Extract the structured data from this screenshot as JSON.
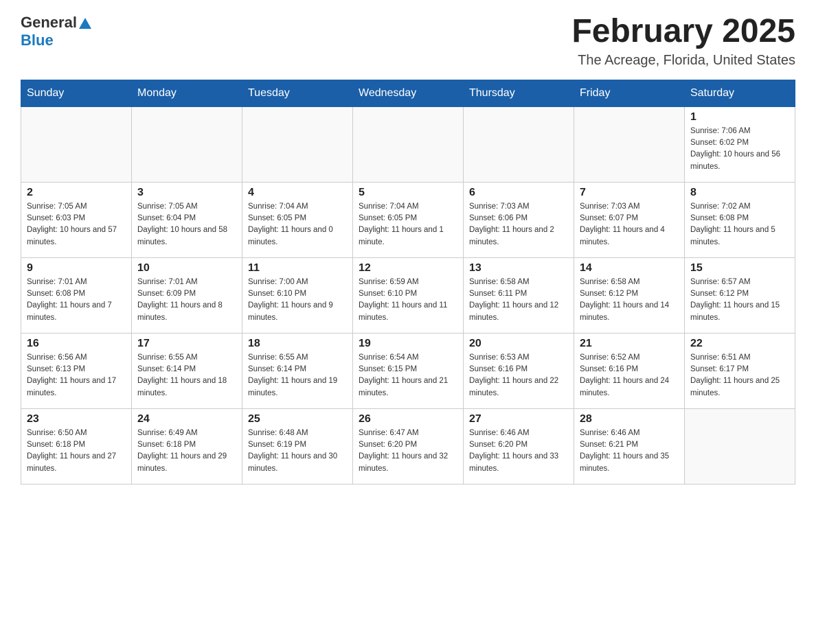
{
  "header": {
    "logo_general": "General",
    "logo_blue": "Blue",
    "title": "February 2025",
    "subtitle": "The Acreage, Florida, United States"
  },
  "days_of_week": [
    "Sunday",
    "Monday",
    "Tuesday",
    "Wednesday",
    "Thursday",
    "Friday",
    "Saturday"
  ],
  "weeks": [
    [
      {
        "day": "",
        "info": ""
      },
      {
        "day": "",
        "info": ""
      },
      {
        "day": "",
        "info": ""
      },
      {
        "day": "",
        "info": ""
      },
      {
        "day": "",
        "info": ""
      },
      {
        "day": "",
        "info": ""
      },
      {
        "day": "1",
        "info": "Sunrise: 7:06 AM\nSunset: 6:02 PM\nDaylight: 10 hours and 56 minutes."
      }
    ],
    [
      {
        "day": "2",
        "info": "Sunrise: 7:05 AM\nSunset: 6:03 PM\nDaylight: 10 hours and 57 minutes."
      },
      {
        "day": "3",
        "info": "Sunrise: 7:05 AM\nSunset: 6:04 PM\nDaylight: 10 hours and 58 minutes."
      },
      {
        "day": "4",
        "info": "Sunrise: 7:04 AM\nSunset: 6:05 PM\nDaylight: 11 hours and 0 minutes."
      },
      {
        "day": "5",
        "info": "Sunrise: 7:04 AM\nSunset: 6:05 PM\nDaylight: 11 hours and 1 minute."
      },
      {
        "day": "6",
        "info": "Sunrise: 7:03 AM\nSunset: 6:06 PM\nDaylight: 11 hours and 2 minutes."
      },
      {
        "day": "7",
        "info": "Sunrise: 7:03 AM\nSunset: 6:07 PM\nDaylight: 11 hours and 4 minutes."
      },
      {
        "day": "8",
        "info": "Sunrise: 7:02 AM\nSunset: 6:08 PM\nDaylight: 11 hours and 5 minutes."
      }
    ],
    [
      {
        "day": "9",
        "info": "Sunrise: 7:01 AM\nSunset: 6:08 PM\nDaylight: 11 hours and 7 minutes."
      },
      {
        "day": "10",
        "info": "Sunrise: 7:01 AM\nSunset: 6:09 PM\nDaylight: 11 hours and 8 minutes."
      },
      {
        "day": "11",
        "info": "Sunrise: 7:00 AM\nSunset: 6:10 PM\nDaylight: 11 hours and 9 minutes."
      },
      {
        "day": "12",
        "info": "Sunrise: 6:59 AM\nSunset: 6:10 PM\nDaylight: 11 hours and 11 minutes."
      },
      {
        "day": "13",
        "info": "Sunrise: 6:58 AM\nSunset: 6:11 PM\nDaylight: 11 hours and 12 minutes."
      },
      {
        "day": "14",
        "info": "Sunrise: 6:58 AM\nSunset: 6:12 PM\nDaylight: 11 hours and 14 minutes."
      },
      {
        "day": "15",
        "info": "Sunrise: 6:57 AM\nSunset: 6:12 PM\nDaylight: 11 hours and 15 minutes."
      }
    ],
    [
      {
        "day": "16",
        "info": "Sunrise: 6:56 AM\nSunset: 6:13 PM\nDaylight: 11 hours and 17 minutes."
      },
      {
        "day": "17",
        "info": "Sunrise: 6:55 AM\nSunset: 6:14 PM\nDaylight: 11 hours and 18 minutes."
      },
      {
        "day": "18",
        "info": "Sunrise: 6:55 AM\nSunset: 6:14 PM\nDaylight: 11 hours and 19 minutes."
      },
      {
        "day": "19",
        "info": "Sunrise: 6:54 AM\nSunset: 6:15 PM\nDaylight: 11 hours and 21 minutes."
      },
      {
        "day": "20",
        "info": "Sunrise: 6:53 AM\nSunset: 6:16 PM\nDaylight: 11 hours and 22 minutes."
      },
      {
        "day": "21",
        "info": "Sunrise: 6:52 AM\nSunset: 6:16 PM\nDaylight: 11 hours and 24 minutes."
      },
      {
        "day": "22",
        "info": "Sunrise: 6:51 AM\nSunset: 6:17 PM\nDaylight: 11 hours and 25 minutes."
      }
    ],
    [
      {
        "day": "23",
        "info": "Sunrise: 6:50 AM\nSunset: 6:18 PM\nDaylight: 11 hours and 27 minutes."
      },
      {
        "day": "24",
        "info": "Sunrise: 6:49 AM\nSunset: 6:18 PM\nDaylight: 11 hours and 29 minutes."
      },
      {
        "day": "25",
        "info": "Sunrise: 6:48 AM\nSunset: 6:19 PM\nDaylight: 11 hours and 30 minutes."
      },
      {
        "day": "26",
        "info": "Sunrise: 6:47 AM\nSunset: 6:20 PM\nDaylight: 11 hours and 32 minutes."
      },
      {
        "day": "27",
        "info": "Sunrise: 6:46 AM\nSunset: 6:20 PM\nDaylight: 11 hours and 33 minutes."
      },
      {
        "day": "28",
        "info": "Sunrise: 6:46 AM\nSunset: 6:21 PM\nDaylight: 11 hours and 35 minutes."
      },
      {
        "day": "",
        "info": ""
      }
    ]
  ]
}
